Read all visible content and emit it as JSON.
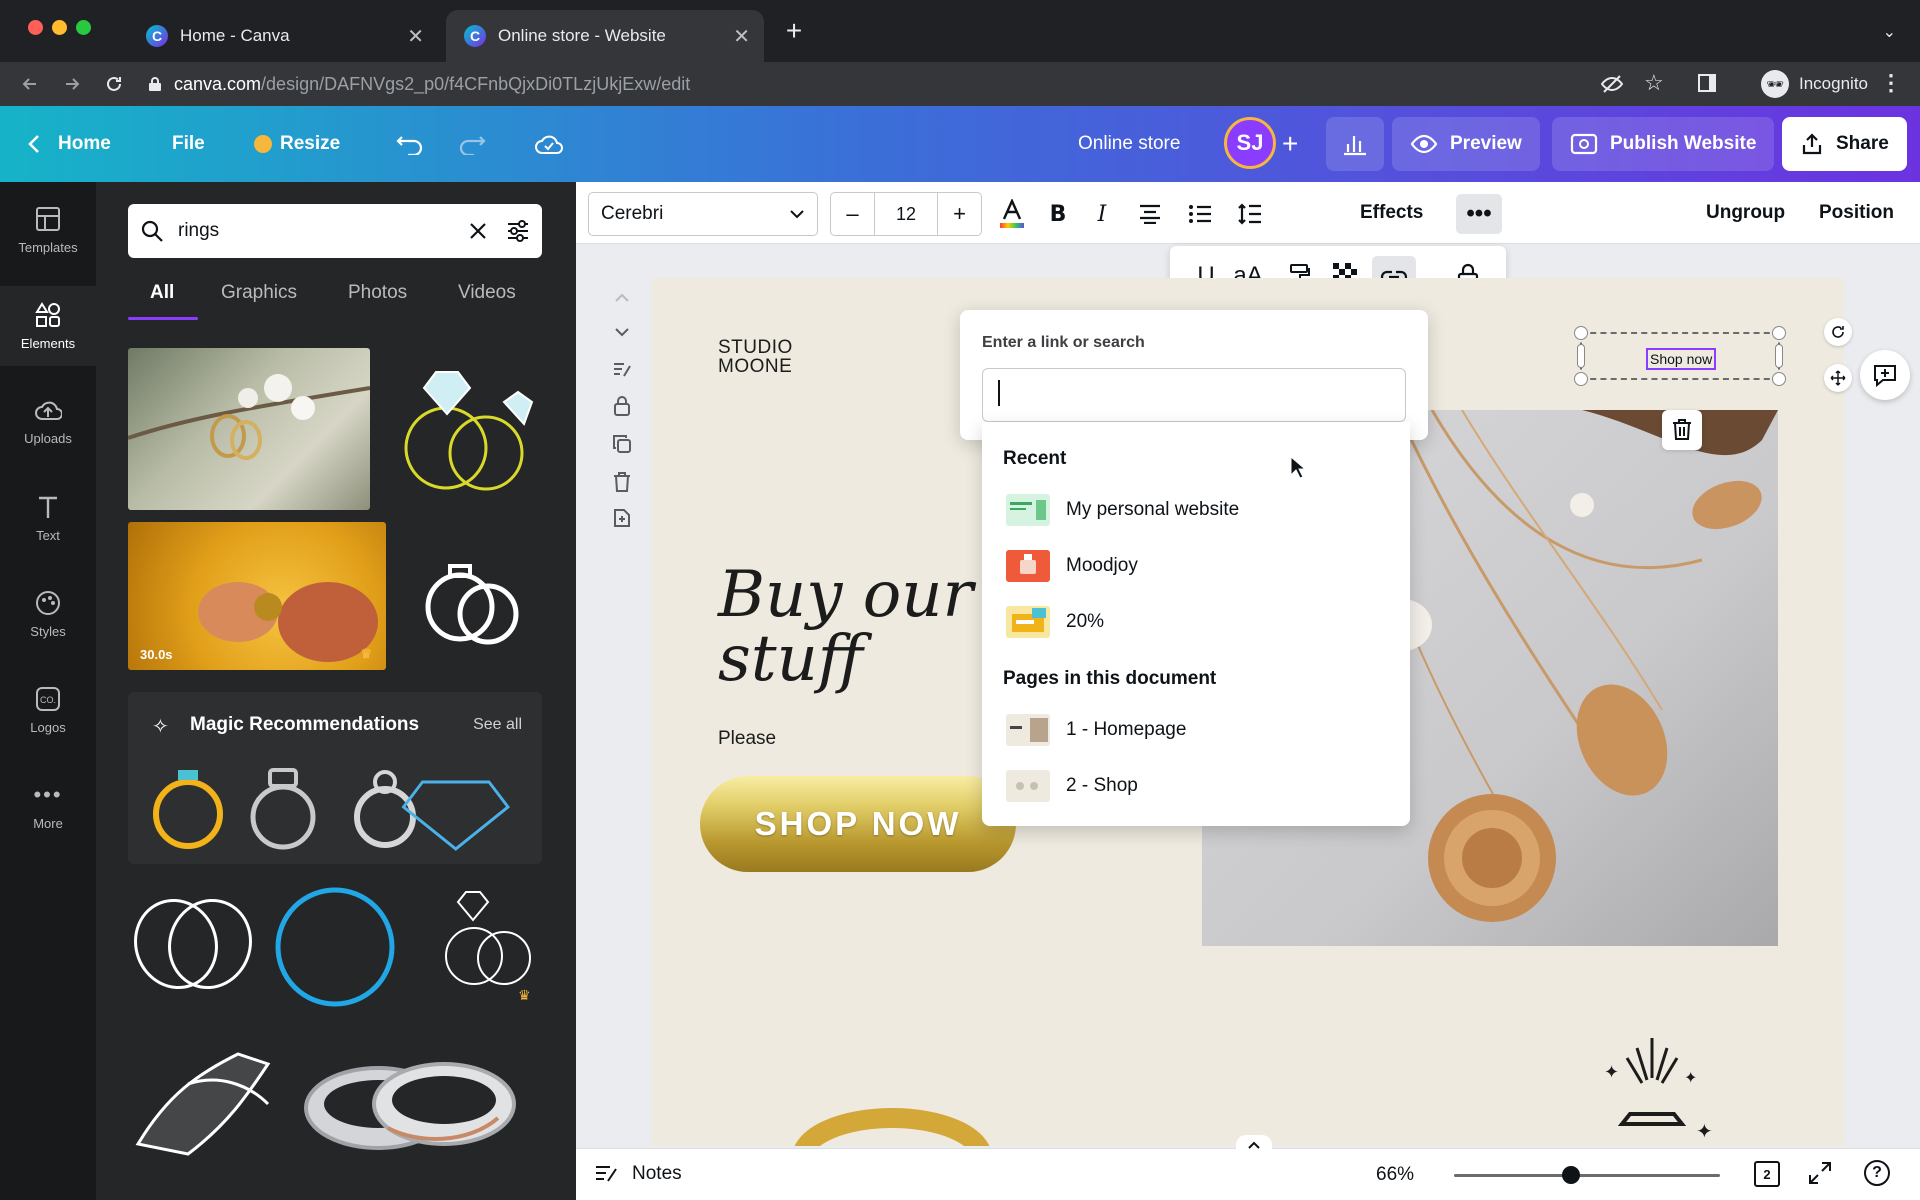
{
  "browser": {
    "tabs": [
      {
        "title": "Home - Canva",
        "active": false
      },
      {
        "title": "Online store - Website",
        "active": true
      }
    ],
    "new_tab_icon": "plus-icon",
    "url_host": "canva.com",
    "url_path": "/design/DAFNVgs2_p0/f4CFnbQjxDi0TLzjUkjExw/edit",
    "profile_label": "Incognito"
  },
  "header": {
    "home_label": "Home",
    "file_label": "File",
    "resize_label": "Resize",
    "doc_title": "Online store",
    "avatar_initials": "SJ",
    "preview_label": "Preview",
    "publish_label": "Publish Website",
    "share_label": "Share"
  },
  "rail": {
    "items": [
      {
        "label": "Templates",
        "icon": "templates-icon"
      },
      {
        "label": "Elements",
        "icon": "elements-icon"
      },
      {
        "label": "Uploads",
        "icon": "uploads-icon"
      },
      {
        "label": "Text",
        "icon": "text-icon"
      },
      {
        "label": "Styles",
        "icon": "styles-icon"
      },
      {
        "label": "Logos",
        "icon": "logos-icon"
      },
      {
        "label": "More",
        "icon": "more-icon"
      }
    ]
  },
  "panel": {
    "search_value": "rings",
    "tabs": [
      "All",
      "Graphics",
      "Photos",
      "Videos"
    ],
    "video_duration": "30.0s",
    "magic_title": "Magic Recommendations",
    "see_all": "See all"
  },
  "toolbar": {
    "font": "Cerebri",
    "size": "12",
    "decrease": "–",
    "increase": "+",
    "effects": "Effects",
    "ungroup": "Ungroup",
    "position": "Position"
  },
  "canvas": {
    "brand": "STUDIO\nMOONE",
    "headline": "Buy our stuff",
    "body": "Please",
    "cta": "SHOP NOW",
    "selected_text": "Shop now"
  },
  "link_popup": {
    "label": "Enter a link or search",
    "input_value": "",
    "recent_heading": "Recent",
    "recent": [
      "My personal website",
      "Moodjoy",
      "20%"
    ],
    "pages_heading": "Pages in this document",
    "pages": [
      "1 - Homepage",
      "2 - Shop"
    ]
  },
  "bottom": {
    "notes_label": "Notes",
    "zoom": "66%",
    "zoom_fraction": 0.44,
    "page_count": "2"
  },
  "colors": {
    "accent": "#8b3dff",
    "header_start": "#16b3c8",
    "header_end": "#6b33e0",
    "page_bg": "#eeeadf"
  }
}
